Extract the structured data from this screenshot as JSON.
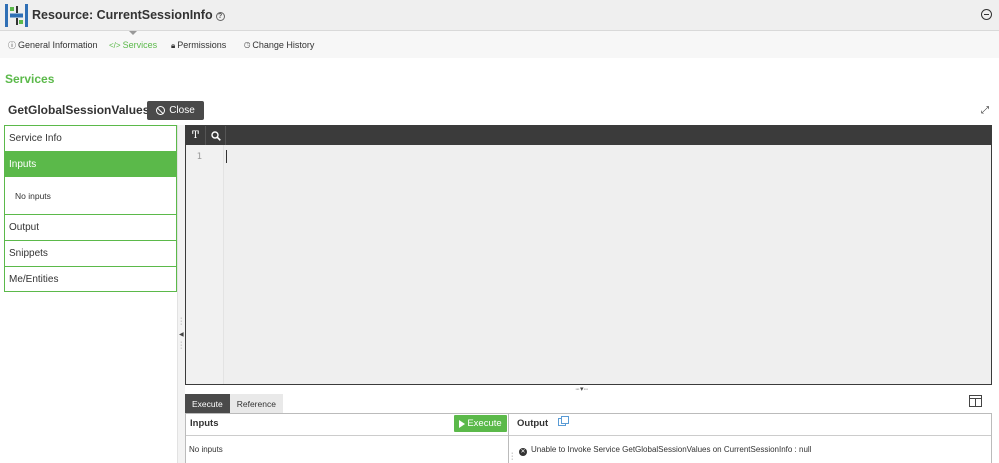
{
  "header": {
    "resource_label": "Resource:",
    "resource_name": "CurrentSessionInfo",
    "help_glyph": "?"
  },
  "tabs": [
    {
      "label": "General Information",
      "icon": "info-circle-icon",
      "active": false
    },
    {
      "label": "Services",
      "icon": "code-icon",
      "active": true
    },
    {
      "label": "Permissions",
      "icon": "lock-icon",
      "active": false
    },
    {
      "label": "Change History",
      "icon": "clock-icon",
      "active": false
    }
  ],
  "section_title": "Services",
  "service": {
    "name": "GetGlobalSessionValues",
    "close_label": "Close"
  },
  "left_panel": {
    "items": [
      "Service Info",
      "Inputs",
      "Output",
      "Snippets",
      "Me/Entities"
    ],
    "active_item": "Inputs",
    "inputs_content": "No inputs"
  },
  "editor": {
    "line_numbers": [
      "1"
    ]
  },
  "bottom_tabs": [
    "Execute",
    "Reference"
  ],
  "inputs_panel": {
    "title": "Inputs",
    "text": "No inputs",
    "execute_label": "Execute"
  },
  "output_panel": {
    "title": "Output",
    "message": "Unable to Invoke Service GetGlobalSessionValues on CurrentSessionInfo : null"
  },
  "colors": {
    "accent": "#5bb94a",
    "dark": "#3b3b3b"
  }
}
